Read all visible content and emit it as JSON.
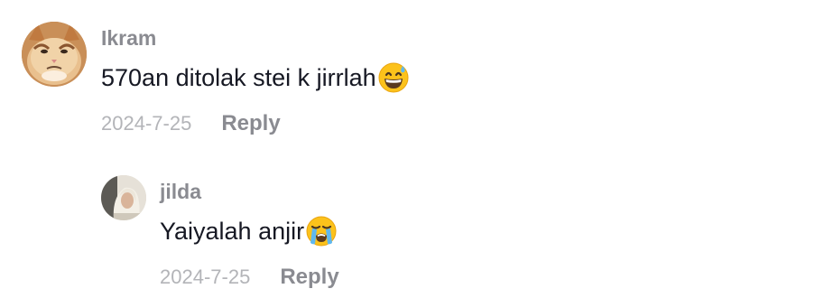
{
  "comments": [
    {
      "username": "Ikram",
      "text": "570an ditolak stei k jirrlah",
      "emoji_icon": "grinning-face-with-sweat-icon",
      "date": "2024-7-25",
      "reply_label": "Reply",
      "avatar_icon": "cat-avatar"
    }
  ],
  "reply": {
    "username": "jilda",
    "text": "Yaiyalah anjir",
    "emoji_icon": "loudly-crying-face-icon",
    "date": "2024-7-25",
    "reply_label": "Reply",
    "avatar_icon": "person-hijab-avatar"
  },
  "colors": {
    "username": "#8a8b91",
    "body_text": "#161823",
    "date": "#b3b4b8",
    "reply": "#8a8b91",
    "background": "#ffffff"
  }
}
